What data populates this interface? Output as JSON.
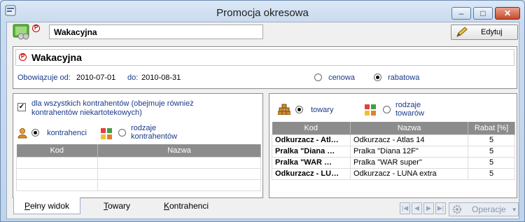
{
  "window": {
    "title": "Promocja okresowa",
    "controls": {
      "minimize": "–",
      "maximize": "□",
      "close": "✕"
    }
  },
  "header": {
    "name_value": "Wakacyjna",
    "badge": "P",
    "edit_label": "Edytuj"
  },
  "promo": {
    "name": "Wakacyjna",
    "badge": "P",
    "valid_from_label": "Obowiązuje od:",
    "valid_from": "2010-07-01",
    "valid_to_label": "do:",
    "valid_to": "2010-08-31",
    "type_options": [
      {
        "label": "cenowa",
        "selected": false
      },
      {
        "label": "rabatowa",
        "selected": true
      }
    ]
  },
  "contractors": {
    "all_checkbox_label_line1": "dla wszystkich kontrahentów (obejmuje również",
    "all_checkbox_label_line2": "kontrahentów niekartotekowych)",
    "all_checked": true,
    "radio_contractors": "kontrahenci",
    "radio_types_line1": "rodzaje",
    "radio_types_line2": "kontrahentów",
    "columns": [
      "Kod",
      "Nazwa"
    ],
    "rows": [
      [
        "",
        ""
      ],
      [
        "",
        ""
      ],
      [
        "",
        ""
      ]
    ]
  },
  "products": {
    "radio_goods": "towary",
    "radio_types_line1": "rodzaje",
    "radio_types_line2": "towarów",
    "columns": [
      "Kod",
      "Nazwa",
      "Rabat [%]"
    ],
    "rows": [
      {
        "code": "Odkurzacz - Atl…",
        "name": "Odkurzacz - Atlas 14",
        "discount": "5"
      },
      {
        "code": "Pralka \"Diana …",
        "name": "Pralka \"Diana 12F\"",
        "discount": "5"
      },
      {
        "code": "Pralka \"WAR …",
        "name": "Pralka \"WAR super\"",
        "discount": "5"
      },
      {
        "code": "Odkurzacz - LU…",
        "name": "Odkurzacz - LUNA extra",
        "discount": "5"
      }
    ]
  },
  "tabs": [
    {
      "label": "Pełny widok",
      "underline": "P",
      "rest": "ełny widok"
    },
    {
      "label": "Towary",
      "underline": "T",
      "rest": "owary"
    },
    {
      "label": "Kontrahenci",
      "underline": "K",
      "rest": "ontrahenci"
    }
  ],
  "bottom": {
    "nav": [
      "|◀",
      "◀",
      "▶",
      "▶|"
    ],
    "operations_label": "Operacje"
  },
  "colors": {
    "badge_red": "#c00000",
    "grid_header": "#8c8c8c",
    "titlebar_blue": "#c9dbef"
  }
}
